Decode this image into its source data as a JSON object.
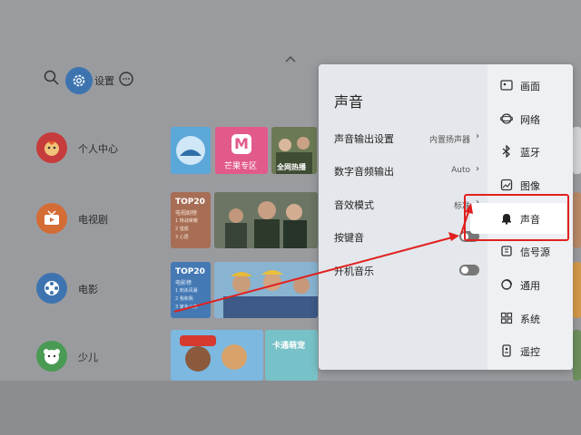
{
  "topbar": {
    "settings_label": "设置"
  },
  "categories": [
    {
      "label": "个人中心",
      "color": "#c63b3b"
    },
    {
      "label": "电视剧",
      "color": "#d46c36"
    },
    {
      "label": "电影",
      "color": "#3d74b0"
    },
    {
      "label": "少儿",
      "color": "#4a9a54"
    }
  ],
  "tiles": {
    "mango_text": "芒果专区",
    "hot_text": "全网热播",
    "tv_rank": {
      "title": "TOP20",
      "subtitle": "电视剧榜",
      "items": [
        "1 特战荣耀",
        "2 猎狐",
        "3 心居"
      ]
    },
    "movie_rank": {
      "title": "TOP20",
      "subtitle": "电影榜",
      "items": [
        "1 刺杀风暴",
        "2 我和我",
        "3 家乡山东"
      ]
    },
    "kids_text": "卡通萌宠"
  },
  "panel": {
    "title": "声音",
    "rows": [
      {
        "label": "声音输出设置",
        "value": "内置扬声器",
        "arrow": "›"
      },
      {
        "label": "数字音频输出",
        "value": "Auto",
        "arrow": "›"
      },
      {
        "label": "音效模式",
        "value": "标准",
        "arrow": "›"
      },
      {
        "label": "按键音",
        "toggle": false
      },
      {
        "label": "开机音乐",
        "toggle": false
      }
    ],
    "nav": [
      {
        "label": "画面",
        "icon": "picture-icon"
      },
      {
        "label": "网络",
        "icon": "network-icon"
      },
      {
        "label": "蓝牙",
        "icon": "bluetooth-icon"
      },
      {
        "label": "图像",
        "icon": "image-icon"
      },
      {
        "label": "声音",
        "icon": "bell-icon",
        "selected": true
      },
      {
        "label": "信号源",
        "icon": "signal-source-icon"
      },
      {
        "label": "通用",
        "icon": "general-icon"
      },
      {
        "label": "系统",
        "icon": "system-icon"
      },
      {
        "label": "遥控",
        "icon": "remote-icon"
      }
    ]
  },
  "colors": {
    "accent": "#3d74b0",
    "highlight": "#e0201e"
  }
}
